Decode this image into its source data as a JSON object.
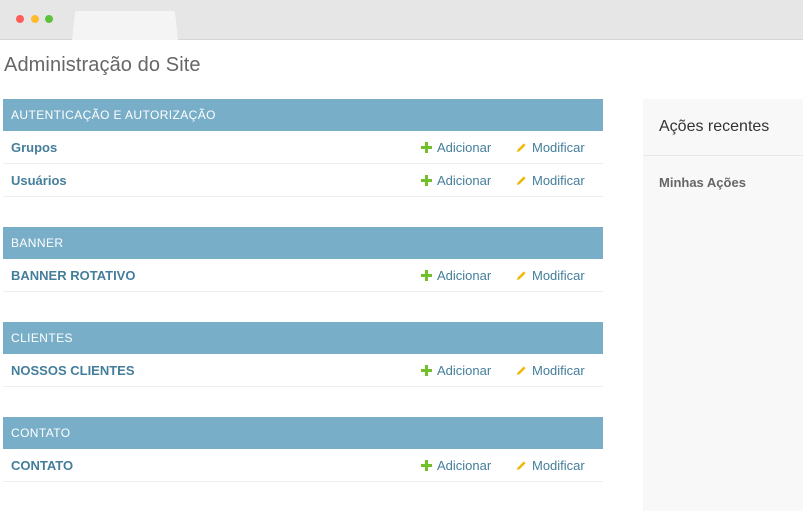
{
  "site_title": "Administração do Site",
  "modules": [
    {
      "caption": "AUTENTICAÇÃO E AUTORIZAÇÃO",
      "rows": [
        {
          "label": "Grupos",
          "add": "Adicionar",
          "change": "Modificar"
        },
        {
          "label": "Usuários",
          "add": "Adicionar",
          "change": "Modificar"
        }
      ]
    },
    {
      "caption": "BANNER",
      "rows": [
        {
          "label": "BANNER ROTATIVO",
          "add": "Adicionar",
          "change": "Modificar"
        }
      ]
    },
    {
      "caption": "CLIENTES",
      "rows": [
        {
          "label": "NOSSOS CLIENTES",
          "add": "Adicionar",
          "change": "Modificar"
        }
      ]
    },
    {
      "caption": "CONTATO",
      "rows": [
        {
          "label": "CONTATO",
          "add": "Adicionar",
          "change": "Modificar"
        }
      ]
    }
  ],
  "sidebar": {
    "title": "Ações recentes",
    "subtitle": "Minhas Ações"
  },
  "colors": {
    "caption_bg": "#79aec8",
    "link": "#447e9b",
    "add_icon": "#70bf2b",
    "change_icon": "#efb80b"
  },
  "icons": {
    "add": "plus-icon",
    "change": "pencil-icon"
  }
}
